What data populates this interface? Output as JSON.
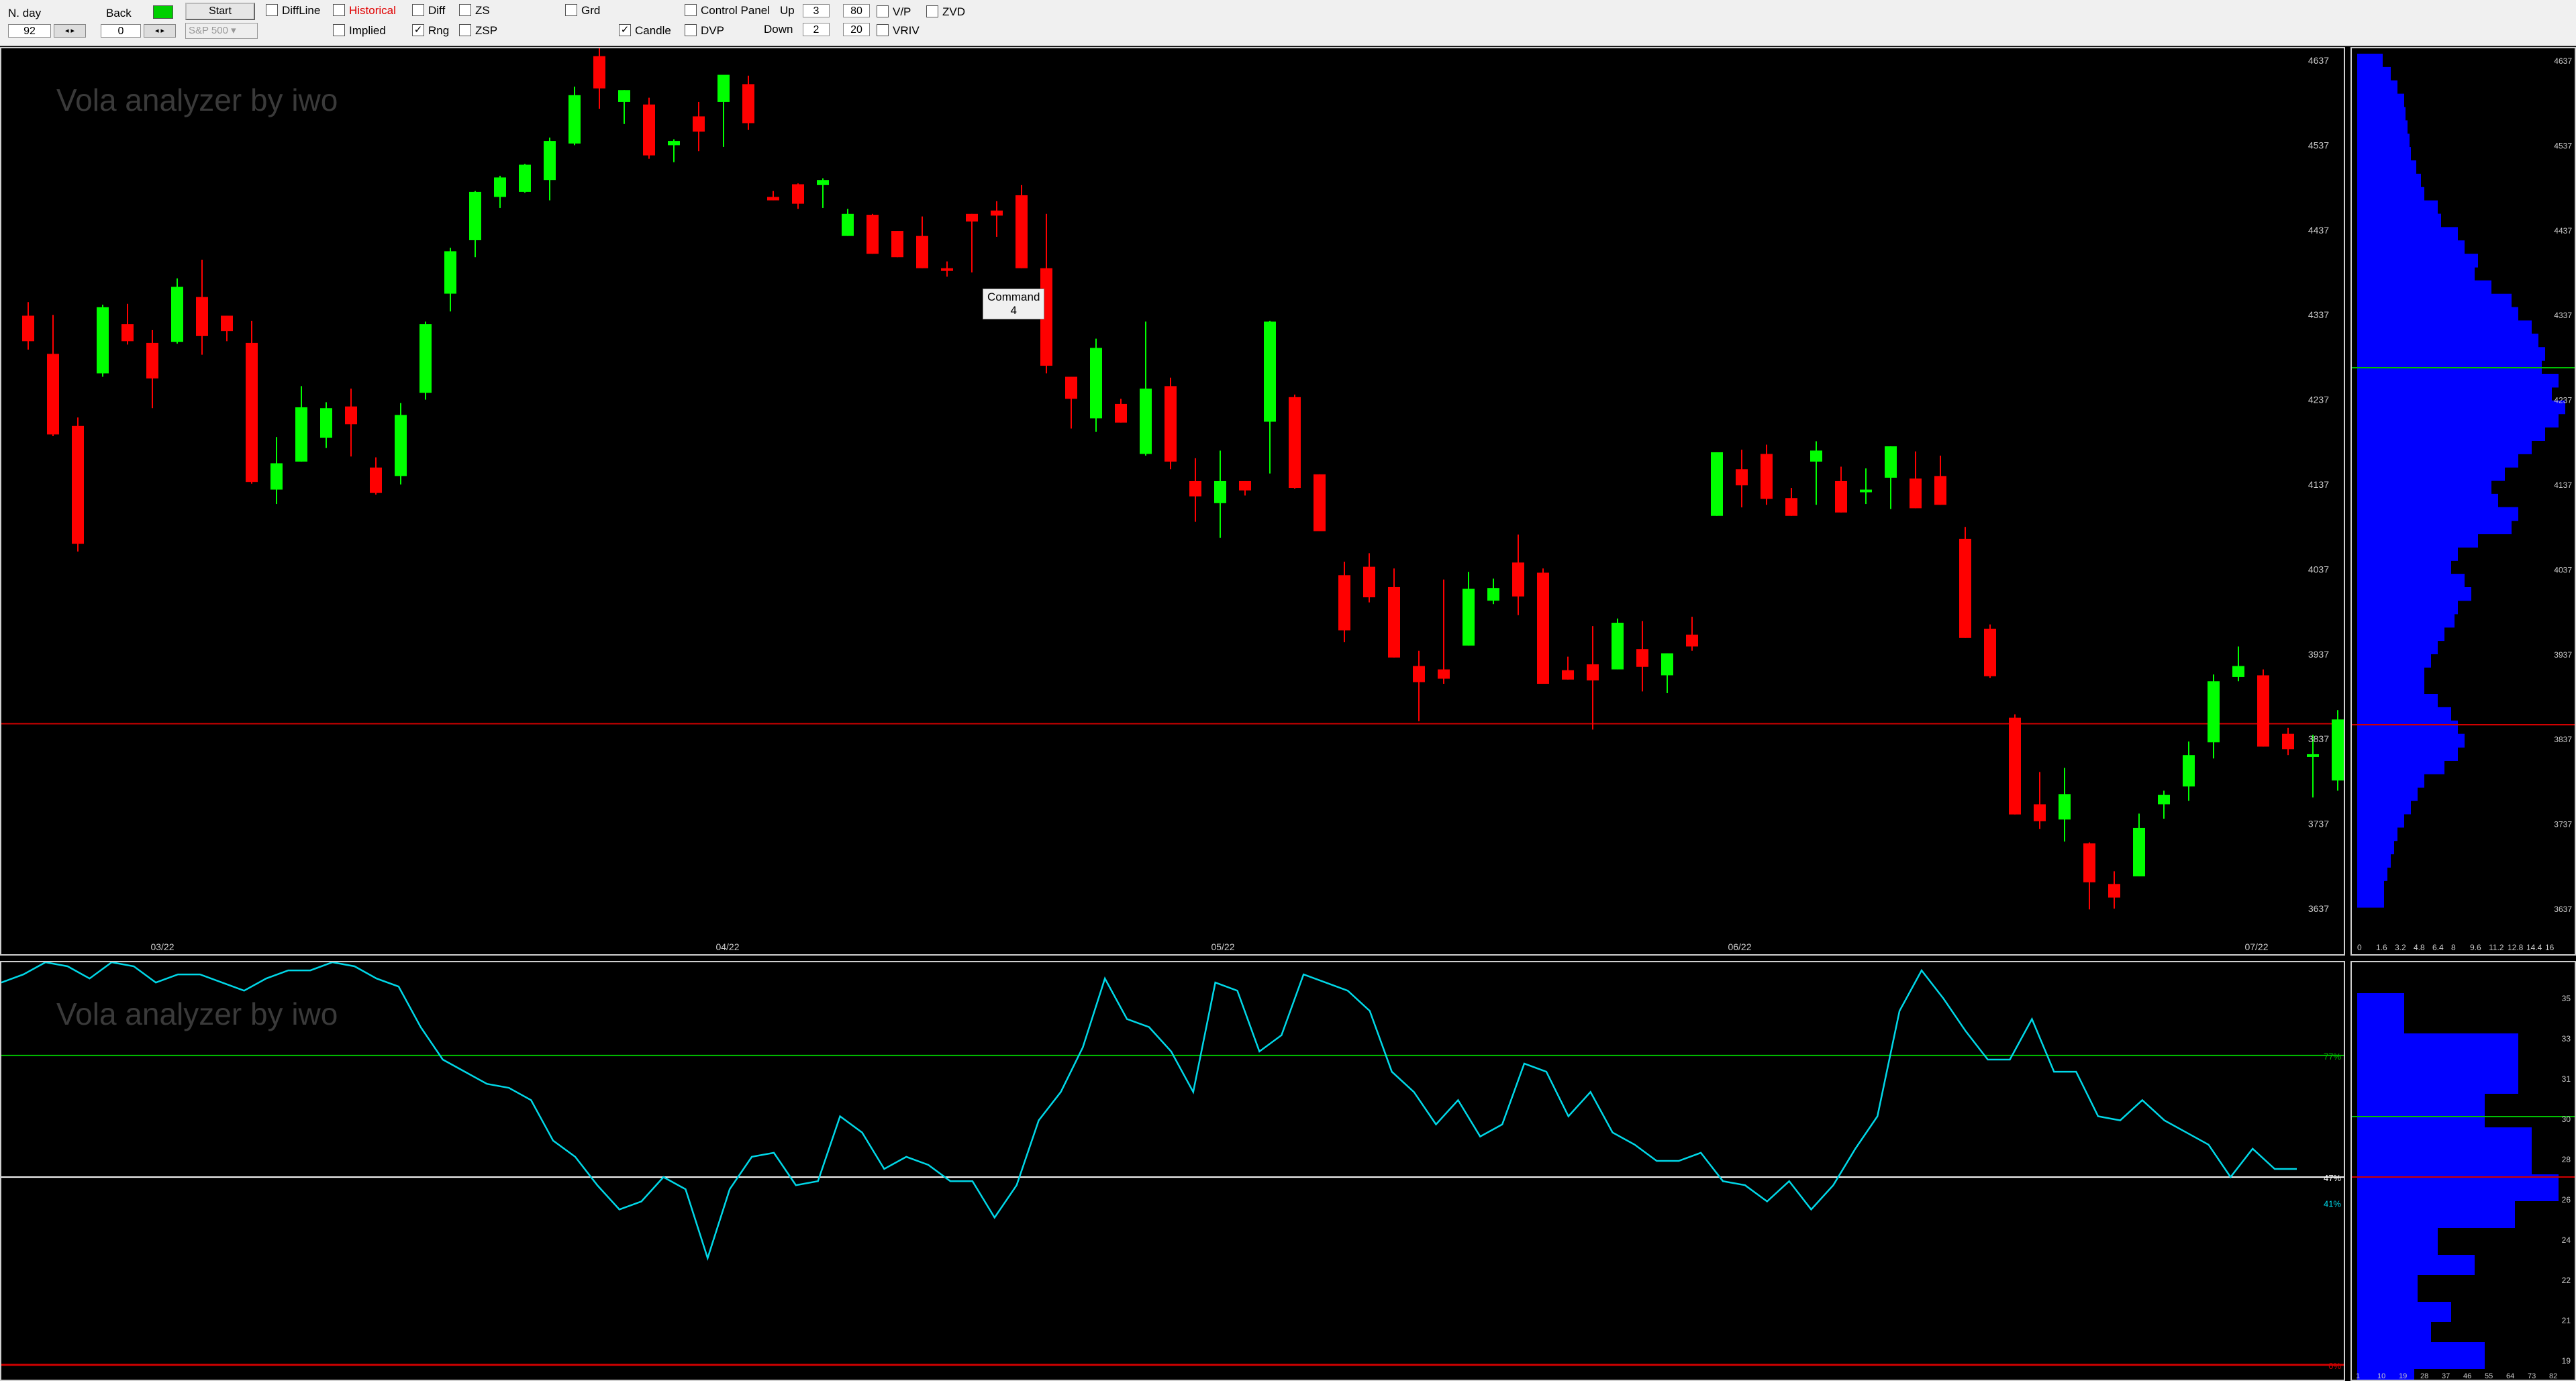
{
  "toolbar": {
    "nday_label": "N. day",
    "nday_value": "92",
    "back_label": "Back",
    "back_value": "0",
    "start_label": "Start",
    "symbol_value": "S&P 500",
    "diffline_label": "DiffLine",
    "historical_label": "Historical",
    "implied_label": "Implied",
    "diff_label": "Diff",
    "rng_label": "Rng",
    "zs_label": "ZS",
    "zsp_label": "ZSP",
    "grd_label": "Grd",
    "candle_label": "Candle",
    "control_panel_label": "Control Panel",
    "dvp_label": "DVP",
    "up_label": "Up",
    "up_value": "3",
    "down_label": "Down",
    "down_value": "2",
    "upper_pct_value": "80",
    "lower_pct_value": "20",
    "vp_label": "V/P",
    "vriv_label": "VRIV",
    "zvd_label": "ZVD",
    "checks": {
      "rng": true,
      "candle": true
    }
  },
  "price_panel": {
    "watermark": "Vola analyzer by iwo",
    "tooltip_line1": "Command",
    "tooltip_line2": "4",
    "y_ticks": [
      "4637",
      "4537",
      "4437",
      "4337",
      "4237",
      "4137",
      "4037",
      "3937",
      "3837",
      "3737",
      "3637"
    ],
    "x_ticks": [
      "03/22",
      "04/22",
      "05/22",
      "06/22",
      "07/22"
    ],
    "current_line": 3855
  },
  "vol_panel": {
    "watermark": "Vola analyzer by iwo",
    "level_labels": [
      "77%",
      "47%",
      "41%",
      "0%"
    ],
    "levels": {
      "upper": 77,
      "mid": 47,
      "current": 41,
      "lower": 0
    }
  },
  "price_histogram": {
    "x_ticks": [
      "0",
      "1.6",
      "3.2",
      "4.8",
      "6.4",
      "8",
      "9.6",
      "11.2",
      "12.8",
      "14.4",
      "16"
    ]
  },
  "vol_histogram": {
    "y_ticks": [
      "35",
      "33",
      "31",
      "30",
      "28",
      "26",
      "24",
      "22",
      "21",
      "19"
    ],
    "x_ticks": [
      "1",
      "10",
      "19",
      "28",
      "37",
      "46",
      "55",
      "64",
      "73",
      "82"
    ]
  },
  "colors": {
    "up_candle": "#00ff00",
    "down_candle": "#ff0000",
    "vol_line": "#00d8e8",
    "hist_bar": "#0000ff",
    "green_line": "#00c000",
    "red_line": "#d00000"
  },
  "chart_data": [
    {
      "type": "candlestick",
      "y_axis": [
        3637,
        4637
      ],
      "candles": [
        [
          4336,
          4306,
          4352,
          4296
        ],
        [
          4291,
          4196,
          4337,
          4194
        ],
        [
          4206,
          4067,
          4216,
          4058
        ],
        [
          4268,
          4346,
          4349,
          4264
        ],
        [
          4326,
          4306,
          4350,
          4302
        ],
        [
          4304,
          4262,
          4319,
          4227
        ],
        [
          4305,
          4370,
          4380,
          4303
        ],
        [
          4358,
          4312,
          4402,
          4290
        ],
        [
          4336,
          4318,
          4333,
          4306
        ],
        [
          4304,
          4140,
          4330,
          4138
        ],
        [
          4131,
          4162,
          4193,
          4114
        ],
        [
          4164,
          4228,
          4253,
          4165
        ],
        [
          4192,
          4227,
          4234,
          4180
        ],
        [
          4229,
          4208,
          4250,
          4170
        ],
        [
          4157,
          4127,
          4169,
          4125
        ],
        [
          4147,
          4219,
          4233,
          4137
        ],
        [
          4245,
          4326,
          4329,
          4237
        ],
        [
          4362,
          4412,
          4416,
          4341
        ],
        [
          4425,
          4482,
          4483,
          4405
        ],
        [
          4476,
          4499,
          4501,
          4463
        ],
        [
          4482,
          4514,
          4515,
          4481
        ],
        [
          4496,
          4542,
          4546,
          4472
        ],
        [
          4539,
          4596,
          4606,
          4537
        ],
        [
          4642,
          4604,
          4656,
          4580
        ],
        [
          4588,
          4602,
          4598,
          4562
        ],
        [
          4585,
          4525,
          4593,
          4521
        ],
        [
          4537,
          4542,
          4544,
          4517
        ],
        [
          4571,
          4553,
          4588,
          4530
        ],
        [
          4588,
          4620,
          4560,
          4535
        ],
        [
          4609,
          4563,
          4619,
          4555
        ],
        [
          4476,
          4472,
          4483,
          4477
        ],
        [
          4491,
          4468,
          4492,
          4462
        ],
        [
          4490,
          4496,
          4498,
          4463
        ],
        [
          4430,
          4456,
          4462,
          4441
        ],
        [
          4455,
          4409,
          4456,
          4412
        ],
        [
          4436,
          4405,
          4435,
          4406
        ],
        [
          4430,
          4392,
          4453,
          4395
        ],
        [
          4392,
          4391,
          4400,
          4382
        ],
        [
          4456,
          4447,
          4442,
          4387
        ],
        [
          4460,
          4454,
          4471,
          4429
        ],
        [
          4478,
          4392,
          4490,
          4407
        ],
        [
          4392,
          4277,
          4456,
          4268
        ],
        [
          4264,
          4238,
          4235,
          4203
        ],
        [
          4215,
          4298,
          4309,
          4199
        ],
        [
          4232,
          4210,
          4238,
          4214
        ],
        [
          4173,
          4250,
          4329,
          4171
        ],
        [
          4253,
          4164,
          4263,
          4155
        ],
        [
          4141,
          4123,
          4168,
          4093
        ],
        [
          4115,
          4141,
          4177,
          4074
        ],
        [
          4141,
          4130,
          4140,
          4124
        ],
        [
          4211,
          4329,
          4330,
          4150
        ],
        [
          4240,
          4133,
          4243,
          4132
        ],
        [
          4149,
          4082,
          4131,
          4099
        ],
        [
          4030,
          3965,
          4046,
          3951
        ],
        [
          4040,
          4004,
          4056,
          3998
        ],
        [
          4016,
          3933,
          4038,
          3940
        ],
        [
          3923,
          3904,
          3941,
          3858
        ],
        [
          3919,
          3908,
          4025,
          3902
        ],
        [
          3947,
          4014,
          4034,
          3986
        ],
        [
          4000,
          4015,
          4026,
          3996
        ],
        [
          4045,
          4005,
          4078,
          3983
        ],
        [
          4033,
          3902,
          4038,
          3929
        ],
        [
          3918,
          3907,
          3934,
          3910
        ],
        [
          3925,
          3906,
          3970,
          3848
        ],
        [
          3919,
          3974,
          3979,
          3936
        ],
        [
          3943,
          3922,
          3976,
          3893
        ],
        [
          3912,
          3938,
          3914,
          3891
        ],
        [
          3960,
          3946,
          3981,
          3941
        ],
        [
          4100,
          4175,
          4147,
          4130
        ],
        [
          4155,
          4136,
          4178,
          4110
        ],
        [
          4173,
          4120,
          4184,
          4113
        ],
        [
          4121,
          4100,
          4133,
          4102
        ],
        [
          4164,
          4177,
          4188,
          4113
        ],
        [
          4141,
          4104,
          4158,
          4130
        ],
        [
          4128,
          4131,
          4156,
          4114
        ],
        [
          4145,
          4182,
          4161,
          4108
        ],
        [
          4144,
          4109,
          4176,
          4119
        ],
        [
          4147,
          4113,
          4171,
          4114
        ],
        [
          4073,
          3956,
          4087,
          3995
        ],
        [
          3967,
          3911,
          3972,
          3909
        ],
        [
          3862,
          3748,
          3866,
          3748
        ],
        [
          3760,
          3740,
          3798,
          3731
        ],
        [
          3742,
          3772,
          3803,
          3716
        ],
        [
          3714,
          3668,
          3715,
          3636
        ],
        [
          3666,
          3650,
          3681,
          3637
        ],
        [
          3675,
          3732,
          3749,
          3714
        ],
        [
          3760,
          3771,
          3776,
          3743
        ],
        [
          3781,
          3818,
          3834,
          3764
        ],
        [
          3833,
          3905,
          3913,
          3814
        ],
        [
          3910,
          3923,
          3946,
          3905
        ],
        [
          3912,
          3828,
          3919,
          3830
        ],
        [
          3843,
          3825,
          3850,
          3818
        ],
        [
          3818,
          3819,
          3842,
          3768
        ],
        [
          3788,
          3860,
          3871,
          3776
        ],
        [
          3798,
          3850,
          3869,
          3770
        ],
        [
          3840,
          3854,
          3869,
          3825
        ]
      ]
    },
    {
      "type": "line",
      "name": "volatility",
      "y_axis": [
        0,
        100
      ],
      "values": [
        95,
        97,
        100,
        99,
        96,
        100,
        99,
        95,
        97,
        97,
        95,
        93,
        96,
        98,
        98,
        100,
        99,
        96,
        94,
        84,
        76,
        73,
        70,
        69,
        66,
        56,
        52,
        45,
        39,
        41,
        47,
        44,
        27,
        44,
        52,
        53,
        45,
        46,
        62,
        58,
        49,
        52,
        50,
        46,
        46,
        37,
        45,
        61,
        68,
        79,
        96,
        86,
        84,
        78,
        68,
        95,
        93,
        78,
        82,
        97,
        95,
        93,
        88,
        73,
        68,
        60,
        66,
        57,
        60,
        75,
        73,
        62,
        68,
        58,
        55,
        51,
        51,
        53,
        46,
        45,
        41,
        46,
        39,
        45,
        54,
        62,
        88,
        98,
        91,
        83,
        76,
        76,
        86,
        73,
        73,
        62,
        61,
        66,
        61,
        58,
        55,
        47,
        54,
        49,
        49
      ]
    }
  ]
}
